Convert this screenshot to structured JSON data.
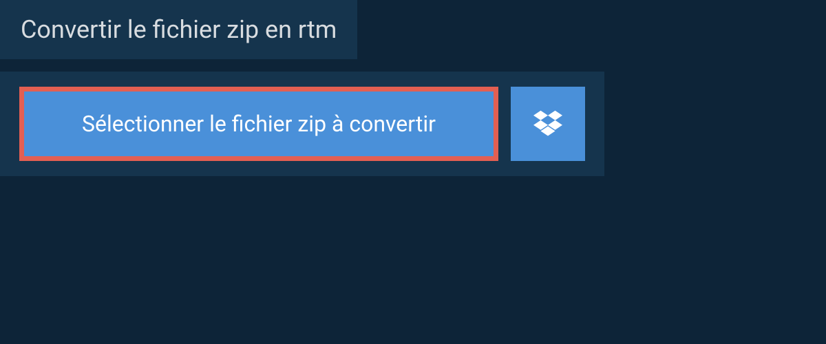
{
  "header": {
    "title": "Convertir le fichier zip en rtm"
  },
  "upload": {
    "select_button_label": "Sélectionner le fichier zip à convertir"
  },
  "colors": {
    "background": "#0d2438",
    "panel": "#15344d",
    "button": "#4a90d9",
    "highlight_border": "#e35f52",
    "text_light": "#d8dce0",
    "text_white": "#ffffff"
  }
}
